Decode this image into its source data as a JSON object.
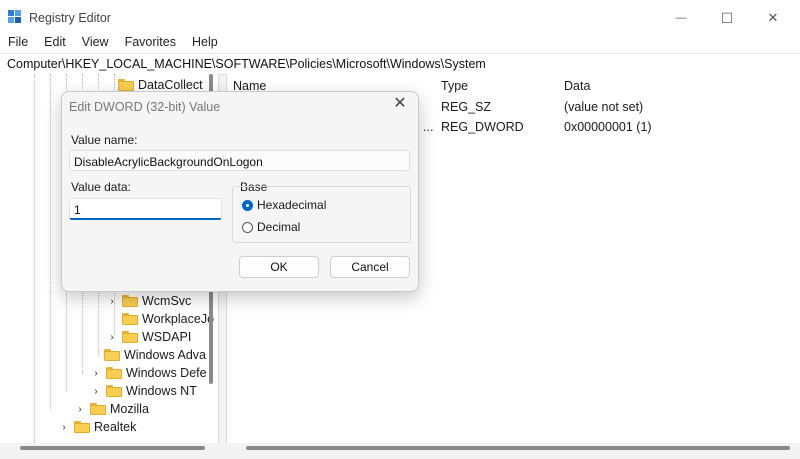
{
  "window": {
    "title": "Registry Editor",
    "minimize_glyph": "—",
    "maximize_glyph": "☐",
    "close_glyph": "✕"
  },
  "menu": [
    "File",
    "Edit",
    "View",
    "Favorites",
    "Help"
  ],
  "address": "Computer\\HKEY_LOCAL_MACHINE\\SOFTWARE\\Policies\\Microsoft\\Windows\\System",
  "tree": {
    "items": [
      {
        "label": "DataCollect"
      },
      {
        "label": "WcmSvc"
      },
      {
        "label": "WorkplaceJo"
      },
      {
        "label": "WSDAPI"
      },
      {
        "label": "Windows Adva"
      },
      {
        "label": "Windows Defe"
      },
      {
        "label": "Windows NT"
      },
      {
        "label": "Mozilla"
      },
      {
        "label": "Realtek"
      }
    ]
  },
  "list": {
    "columns": {
      "name": "Name",
      "type": "Type",
      "data": "Data"
    },
    "rows": [
      {
        "type": "REG_SZ",
        "data": "(value not set)"
      },
      {
        "name_tail": "...",
        "type": "REG_DWORD",
        "data": "0x00000001 (1)"
      }
    ]
  },
  "dialog": {
    "title": "Edit DWORD (32-bit) Value",
    "close_glyph": "✕",
    "value_name_label": "Value name:",
    "value_name": "DisableAcrylicBackgroundOnLogon",
    "value_data_label": "Value data:",
    "value_data": "1",
    "base_label": "Base",
    "base_options": [
      {
        "label": "Hexadecimal",
        "selected": true
      },
      {
        "label": "Decimal",
        "selected": false
      }
    ],
    "ok_label": "OK",
    "cancel_label": "Cancel"
  },
  "colors": {
    "accent": "#0067c0",
    "folder": "#f7cd52"
  }
}
